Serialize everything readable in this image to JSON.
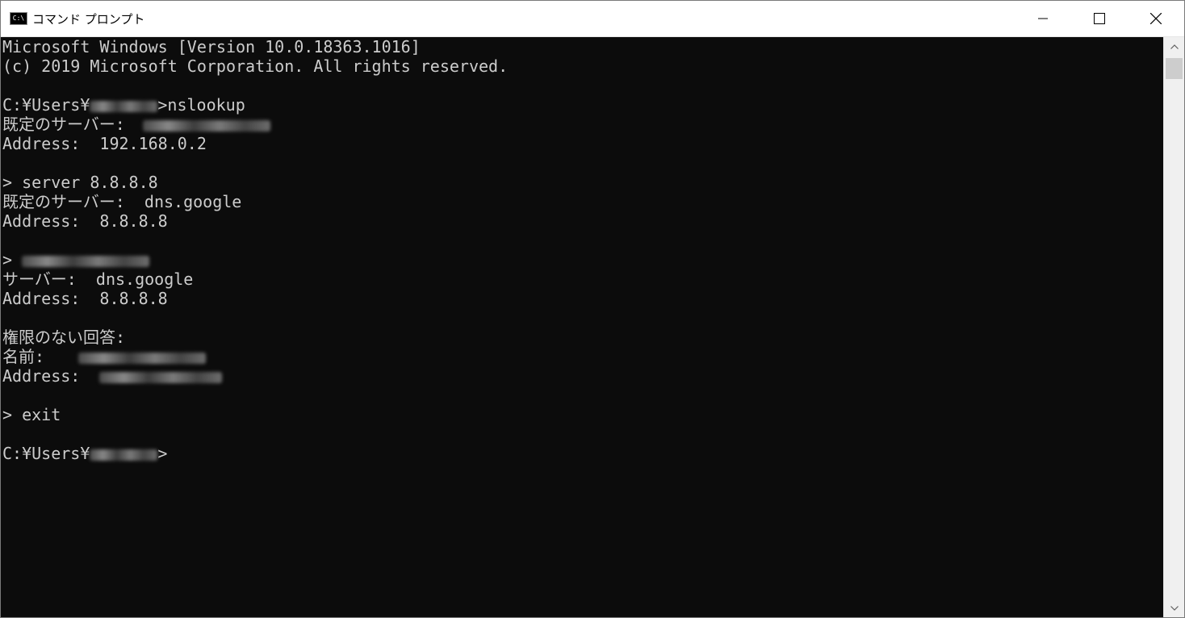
{
  "window": {
    "title": "コマンド プロンプト",
    "icon_label": "C:\\",
    "icon": "cmd-icon"
  },
  "controls": {
    "minimize_icon": "minimize-icon",
    "maximize_icon": "maximize-icon",
    "close_icon": "close-icon"
  },
  "console": {
    "lines": {
      "l01": "Microsoft Windows [Version 10.0.18363.1016]",
      "l02": "(c) 2019 Microsoft Corporation. All rights reserved.",
      "l03a": "C:¥Users¥",
      "l03b": ">nslookup",
      "l04": "既定のサーバー:",
      "l05": "Address:  192.168.0.2",
      "l06": "> server 8.8.8.8",
      "l07": "既定のサーバー:  dns.google",
      "l08": "Address:  8.8.8.8",
      "l09": ">",
      "l10": "サーバー:  dns.google",
      "l11": "Address:  8.8.8.8",
      "l12": "権限のない回答:",
      "l13": "名前:",
      "l14": "Address:",
      "l15": "> exit",
      "l16a": "C:¥Users¥",
      "l16b": ">"
    }
  },
  "colors": {
    "console_bg": "#0c0c0c",
    "console_fg": "#cccccc",
    "titlebar_bg": "#ffffff"
  }
}
